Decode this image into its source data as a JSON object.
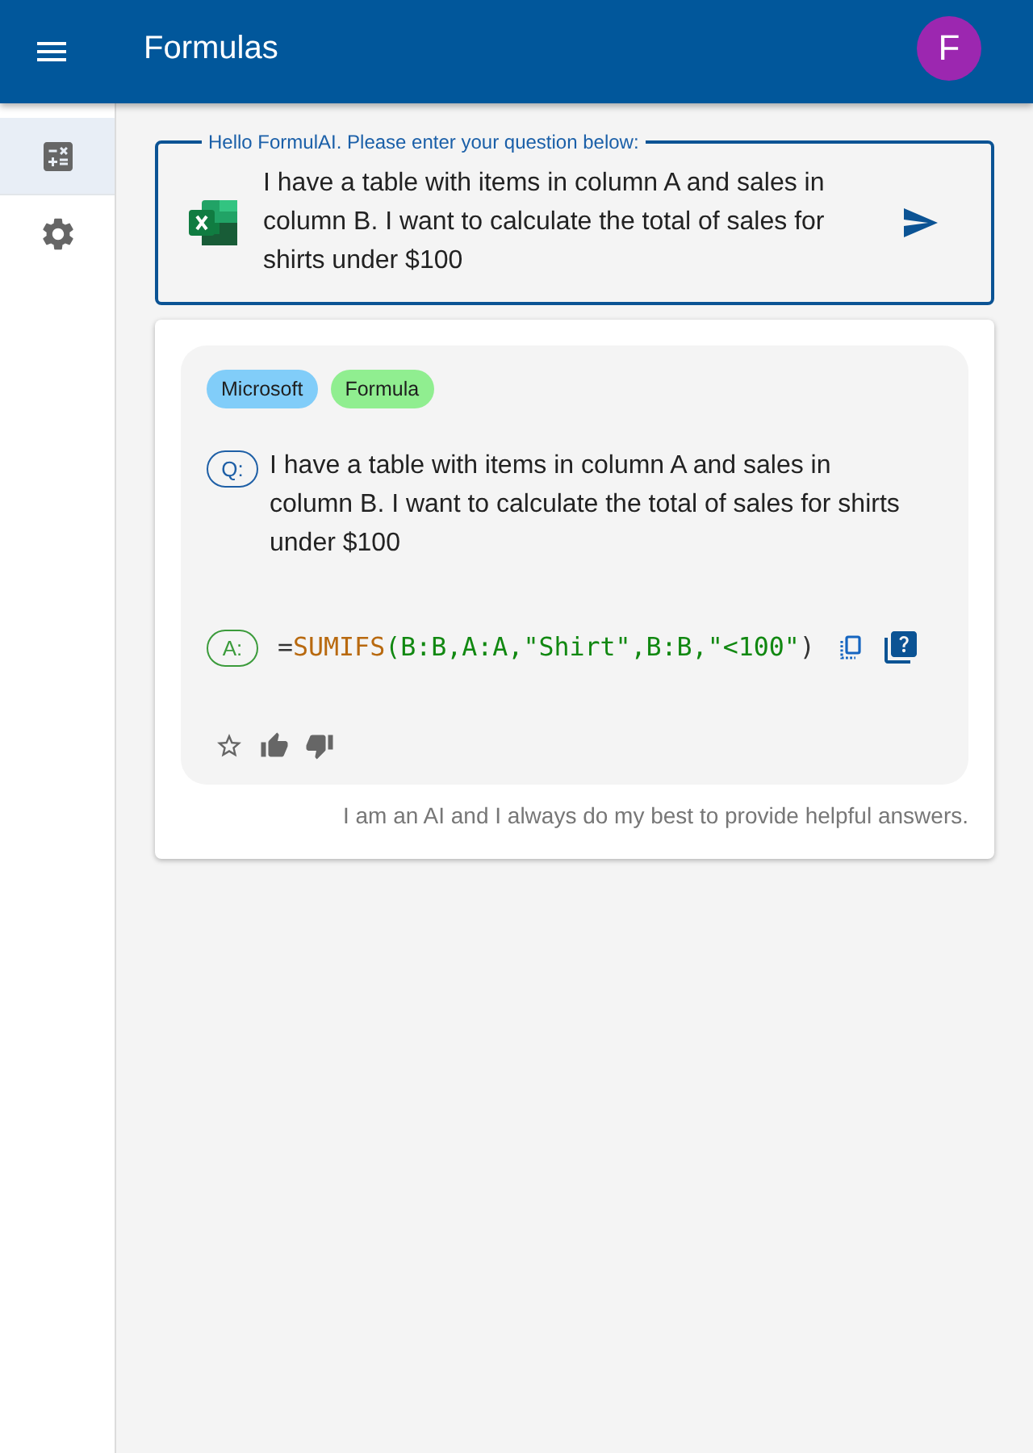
{
  "app_bar": {
    "title": "Formulas",
    "avatar": "F"
  },
  "sidebar": {
    "items": [
      {
        "kind": "formulas",
        "selected": true
      },
      {
        "kind": "settings",
        "selected": false
      }
    ]
  },
  "question_field": {
    "label": "Hello FormulAI. Please enter your question below:",
    "value": "I have a table with items in column A and sales in column B. I want to calculate the total of sales for shirts under $100"
  },
  "answer_card": {
    "tags": [
      {
        "label": "Microsoft",
        "color": "#81cdf9"
      },
      {
        "label": "Formula",
        "color": "#90ee90"
      }
    ],
    "question": {
      "badge": "Q:",
      "text": "I have a table with items in column A and sales in column B. I want to calculate the total of sales for shirts under $100"
    },
    "answer": {
      "badge": "A:",
      "tokens": [
        {
          "kind": "plain",
          "text": "="
        },
        {
          "kind": "function",
          "text": "SUMIFS"
        },
        {
          "kind": "argument",
          "text": "(B:B,A:A,\"Shirt\",B:B,\"<100\""
        },
        {
          "kind": "plain",
          "text": ")"
        }
      ]
    },
    "disclaimer": "I am an AI and I always do my best to provide helpful answers."
  }
}
